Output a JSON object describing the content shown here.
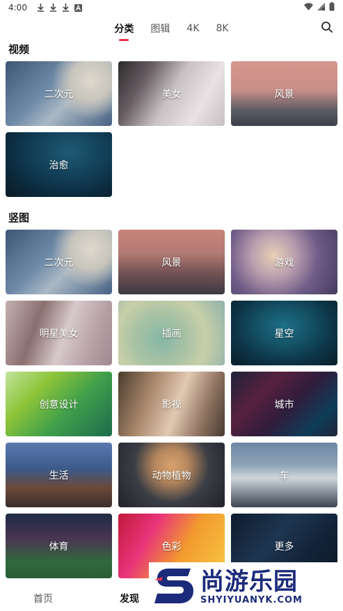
{
  "status_bar": {
    "time": "4:00",
    "left_icons": [
      "download-icon",
      "download-icon",
      "download-icon",
      "font-icon"
    ],
    "right_icons": [
      "wifi-icon",
      "signal-icon",
      "battery-icon"
    ]
  },
  "tabs": [
    {
      "label": "分类",
      "active": true
    },
    {
      "label": "图辑",
      "active": false
    },
    {
      "label": "4K",
      "active": false
    },
    {
      "label": "8K",
      "active": false
    }
  ],
  "accent_color": "#e8334a",
  "sections": [
    {
      "title": "视频",
      "items": [
        {
          "label": "二次元"
        },
        {
          "label": "美女"
        },
        {
          "label": "风景"
        },
        {
          "label": "治愈"
        }
      ]
    },
    {
      "title": "竖图",
      "items": [
        {
          "label": "二次元"
        },
        {
          "label": "风景"
        },
        {
          "label": "游戏"
        },
        {
          "label": "明星美女"
        },
        {
          "label": "插画"
        },
        {
          "label": "星空"
        },
        {
          "label": "创意设计"
        },
        {
          "label": "影视"
        },
        {
          "label": "城市"
        },
        {
          "label": "生活"
        },
        {
          "label": "动物植物"
        },
        {
          "label": "车"
        },
        {
          "label": "体育"
        },
        {
          "label": "色彩"
        },
        {
          "label": "更多"
        }
      ]
    }
  ],
  "bottom_nav": [
    {
      "label": "首页",
      "active": false
    },
    {
      "label": "发现",
      "active": true
    }
  ],
  "watermark": {
    "title": "尚游乐园",
    "url": "SHYIYUANYK.COM"
  }
}
